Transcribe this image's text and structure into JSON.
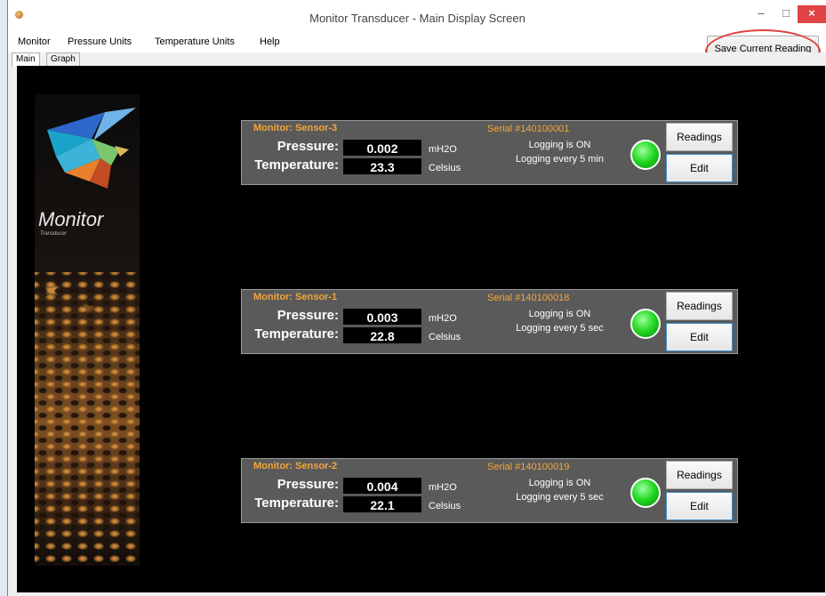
{
  "window": {
    "title": "Monitor Transducer - Main Display Screen",
    "minimize_glyph": "–",
    "maximize_glyph": "□",
    "close_glyph": "×"
  },
  "menu": {
    "items": [
      "Monitor",
      "Pressure Units",
      "Temperature Units",
      "Help"
    ]
  },
  "toolbar": {
    "save_label": "Save Current Reading"
  },
  "tabs": [
    {
      "label": "Main",
      "active": true
    },
    {
      "label": "Graph",
      "active": false
    }
  ],
  "brand": {
    "name": "Monitor",
    "subtitle": "Transducer"
  },
  "labels": {
    "pressure": "Pressure:",
    "temperature": "Temperature:",
    "readings_button": "Readings",
    "edit_button": "Edit"
  },
  "sensors": [
    {
      "title": "Monitor: Sensor-3",
      "serial": "Serial #140100001",
      "pressure": "0.002",
      "pressure_unit": "mH2O",
      "temperature": "23.3",
      "temperature_unit": "Celsius",
      "logging_state": "Logging is ON",
      "logging_interval": "Logging every 5 min",
      "status_color": "#1fd61f"
    },
    {
      "title": "Monitor: Sensor-1",
      "serial": "Serial #140100018",
      "pressure": "0.003",
      "pressure_unit": "mH2O",
      "temperature": "22.8",
      "temperature_unit": "Celsius",
      "logging_state": "Logging is ON",
      "logging_interval": "Logging every 5 sec",
      "status_color": "#1fd61f"
    },
    {
      "title": "Monitor: Sensor-2",
      "serial": "Serial #140100019",
      "pressure": "0.004",
      "pressure_unit": "mH2O",
      "temperature": "22.1",
      "temperature_unit": "Celsius",
      "logging_state": "Logging is ON",
      "logging_interval": "Logging every 5 sec",
      "status_color": "#1fd61f"
    }
  ],
  "colors": {
    "panel_title": "#f2a63b",
    "panel_bg": "#5a5a5a",
    "content_bg": "#000000",
    "annotation": "#e0403c"
  }
}
